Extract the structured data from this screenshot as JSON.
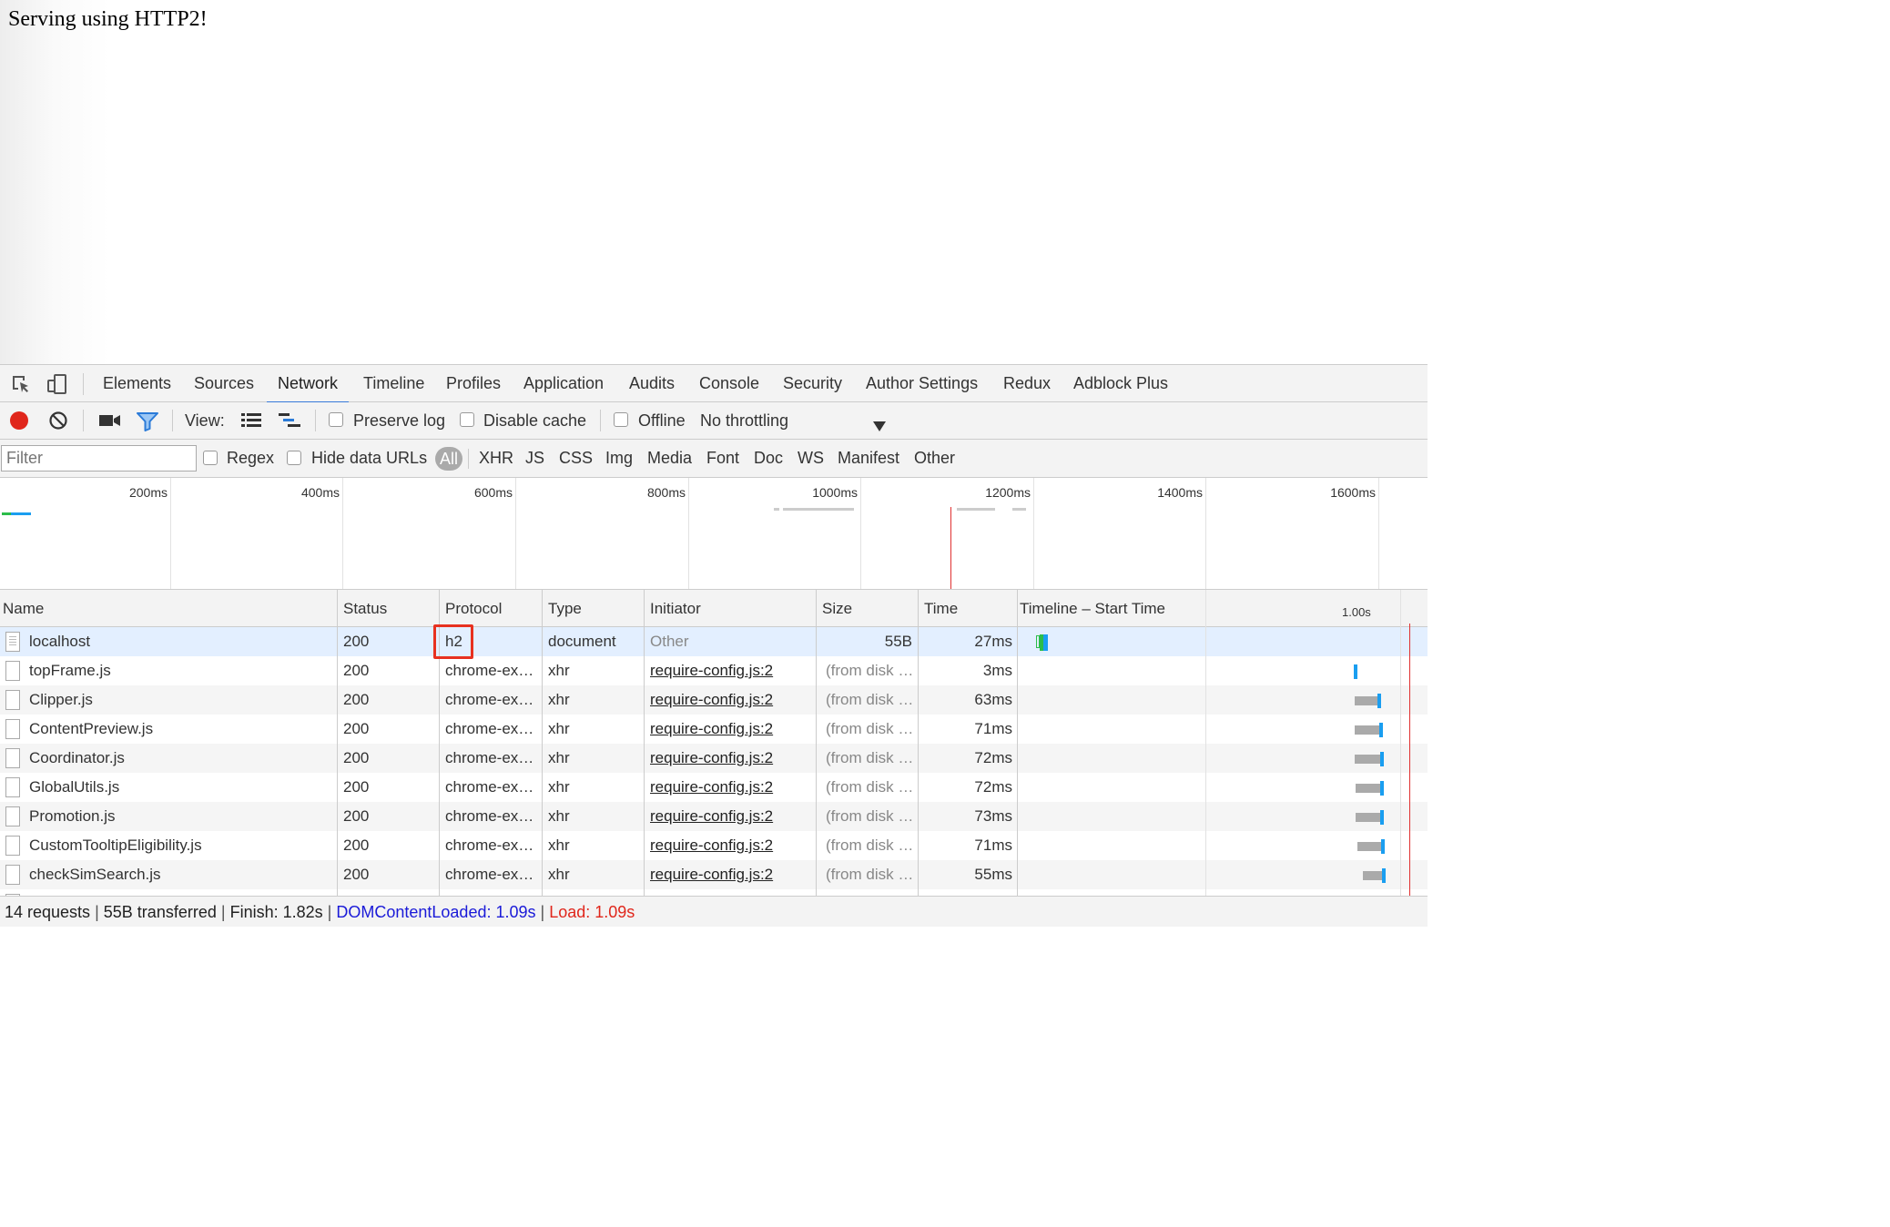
{
  "page": {
    "text": "Serving using HTTP2!"
  },
  "tabs": {
    "items": [
      "Elements",
      "Sources",
      "Network",
      "Timeline",
      "Profiles",
      "Application",
      "Audits",
      "Console",
      "Security",
      "Author Settings",
      "Redux",
      "Adblock Plus"
    ],
    "active": "Network"
  },
  "toolbar": {
    "view_label": "View:",
    "preserve_log": "Preserve log",
    "disable_cache": "Disable cache",
    "offline": "Offline",
    "throttling": "No throttling"
  },
  "filter": {
    "placeholder": "Filter",
    "regex": "Regex",
    "hide_data_urls": "Hide data URLs",
    "types": [
      "All",
      "XHR",
      "JS",
      "CSS",
      "Img",
      "Media",
      "Font",
      "Doc",
      "WS",
      "Manifest",
      "Other"
    ],
    "active_type": "All"
  },
  "overview": {
    "ticks": [
      "200ms",
      "400ms",
      "600ms",
      "800ms",
      "1000ms",
      "1200ms",
      "1400ms",
      "1600ms"
    ]
  },
  "table": {
    "columns": [
      "Name",
      "Status",
      "Protocol",
      "Type",
      "Initiator",
      "Size",
      "Time",
      "Timeline – Start Time"
    ],
    "waterfall_tick": "1.00s",
    "rows": [
      {
        "name": "localhost",
        "status": "200",
        "protocol": "h2",
        "type": "document",
        "initiator": "Other",
        "size": "55B",
        "time": "27ms"
      },
      {
        "name": "topFrame.js",
        "status": "200",
        "protocol": "chrome-ex…",
        "type": "xhr",
        "initiator": "require-config.js:2",
        "size": "(from disk …",
        "time": "3ms"
      },
      {
        "name": "Clipper.js",
        "status": "200",
        "protocol": "chrome-ex…",
        "type": "xhr",
        "initiator": "require-config.js:2",
        "size": "(from disk …",
        "time": "63ms"
      },
      {
        "name": "ContentPreview.js",
        "status": "200",
        "protocol": "chrome-ex…",
        "type": "xhr",
        "initiator": "require-config.js:2",
        "size": "(from disk …",
        "time": "71ms"
      },
      {
        "name": "Coordinator.js",
        "status": "200",
        "protocol": "chrome-ex…",
        "type": "xhr",
        "initiator": "require-config.js:2",
        "size": "(from disk …",
        "time": "72ms"
      },
      {
        "name": "GlobalUtils.js",
        "status": "200",
        "protocol": "chrome-ex…",
        "type": "xhr",
        "initiator": "require-config.js:2",
        "size": "(from disk …",
        "time": "72ms"
      },
      {
        "name": "Promotion.js",
        "status": "200",
        "protocol": "chrome-ex…",
        "type": "xhr",
        "initiator": "require-config.js:2",
        "size": "(from disk …",
        "time": "73ms"
      },
      {
        "name": "CustomTooltipEligibility.js",
        "status": "200",
        "protocol": "chrome-ex…",
        "type": "xhr",
        "initiator": "require-config.js:2",
        "size": "(from disk …",
        "time": "71ms"
      },
      {
        "name": "checkSimSearch.js",
        "status": "200",
        "protocol": "chrome-ex…",
        "type": "xhr",
        "initiator": "require-config.js:2",
        "size": "(from disk …",
        "time": "55ms"
      }
    ]
  },
  "status": {
    "requests": "14 requests",
    "transferred": "55B transferred",
    "finish": "Finish: 1.82s",
    "dom_content_loaded": "DOMContentLoaded: 1.09s",
    "load": "Load: 1.09s"
  },
  "colors": {
    "accent": "#3879d9",
    "record": "#e0261b",
    "dcl": "#1a1ad8",
    "load": "#e0261b",
    "highlight": "#e8311f"
  }
}
